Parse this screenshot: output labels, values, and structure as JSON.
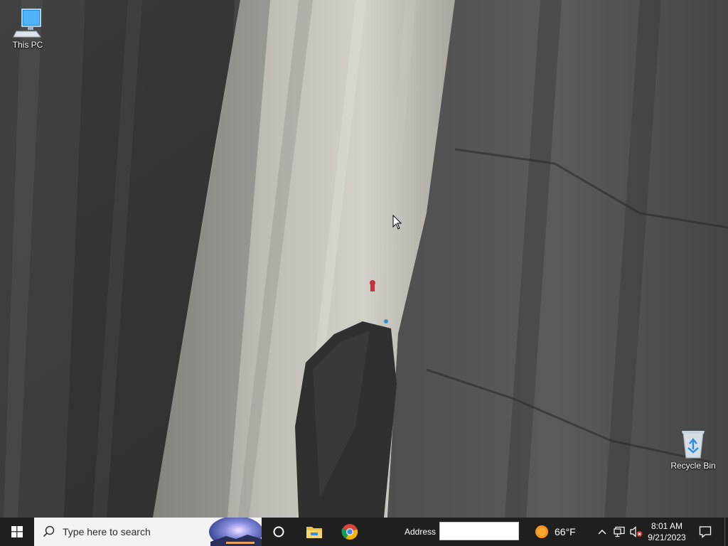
{
  "desktop": {
    "icons": [
      {
        "label": "This PC",
        "icon": "this-pc-icon"
      },
      {
        "label": "Recycle Bin",
        "icon": "recycle-bin-icon"
      }
    ]
  },
  "taskbar": {
    "search_placeholder": "Type here to search",
    "address_label": "Address",
    "address_value": "",
    "weather": {
      "temperature": "66°F",
      "icon": "sun-icon"
    },
    "clock": {
      "time": "8:01 AM",
      "date": "9/21/2023"
    },
    "pinned": [
      "cortana-icon",
      "file-explorer-icon",
      "chrome-icon"
    ],
    "tray": [
      "chevron-up-icon",
      "network-icon",
      "volume-muted-icon",
      "notification-icon"
    ]
  },
  "colors": {
    "taskbar_bg": "#1f1f1f",
    "search_bg": "#f3f3f3",
    "weather_sun": "#f7941d"
  }
}
